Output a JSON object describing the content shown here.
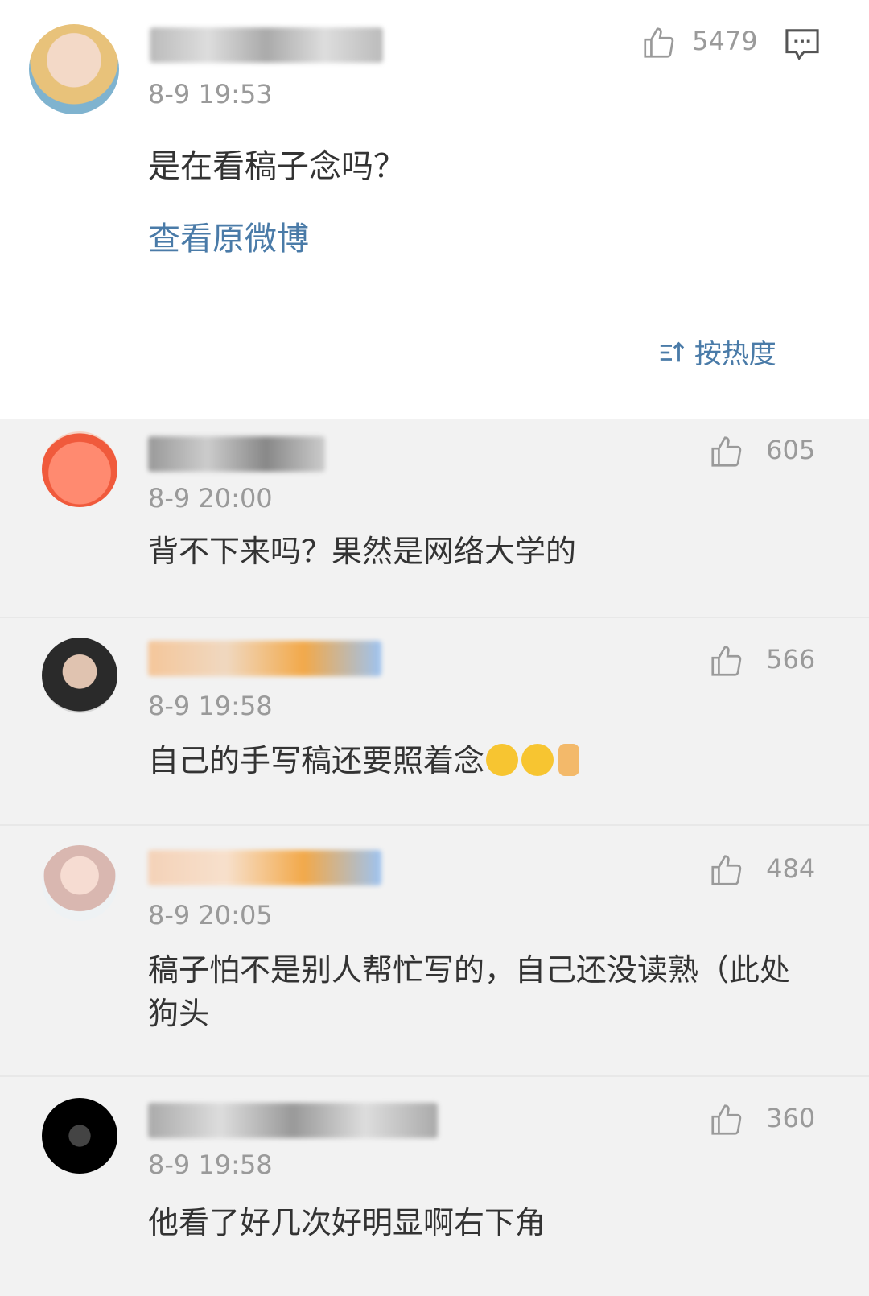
{
  "post": {
    "time": "8-9 19:53",
    "likes": "5479",
    "text": "是在看稿子念吗？",
    "view_original": "查看原微博"
  },
  "sort_label": "按热度",
  "comments": [
    {
      "time": "8-9 20:00",
      "likes": "605",
      "text": "背不下来吗？果然是网络大学的"
    },
    {
      "time": "8-9 19:58",
      "likes": "566",
      "text": "自己的手写稿还要照着念"
    },
    {
      "time": "8-9 20:05",
      "likes": "484",
      "text": "稿子怕不是别人帮忙写的，自己还没读熟（此处狗头"
    },
    {
      "time": "8-9 19:58",
      "likes": "360",
      "text": "他看了好几次好明显啊右下角"
    }
  ],
  "icons": {
    "like": "thumbs-up-icon",
    "comment": "comment-bubble-icon",
    "sort": "sort-icon",
    "emoji": [
      "laughing-tears-emoji",
      "grinning-emoji",
      "thumbs-up-emoji"
    ]
  },
  "colors": {
    "link": "#4a7ba8",
    "meta": "#9a9a9a",
    "reply_bg": "#f2f2f2"
  }
}
